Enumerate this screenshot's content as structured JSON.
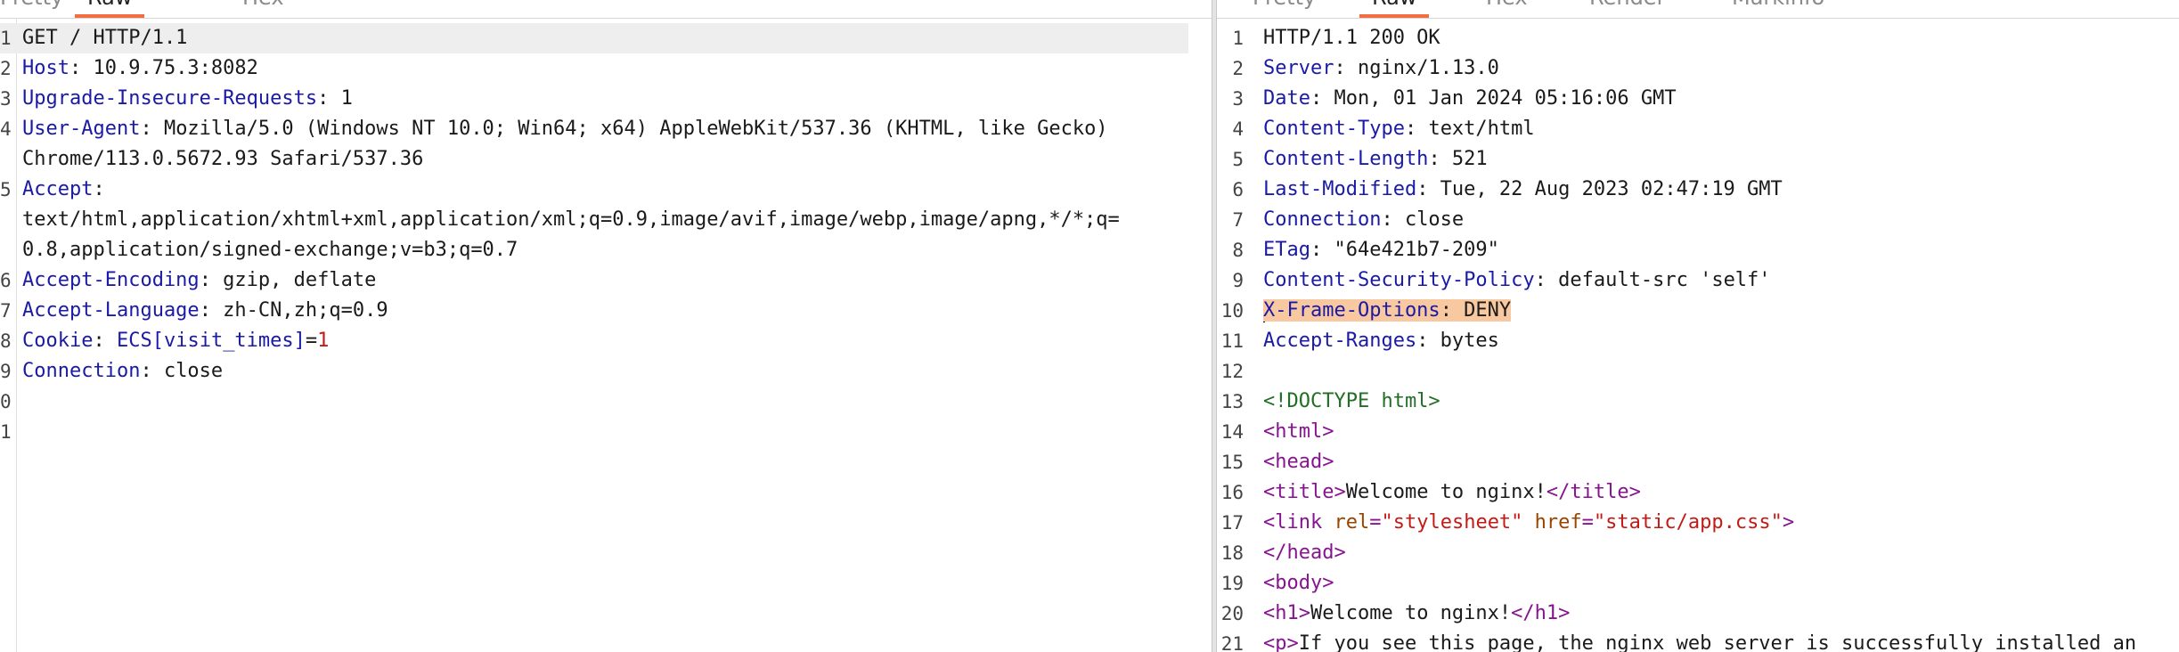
{
  "request": {
    "tabs": [
      "Pretty",
      "Raw",
      "Hex"
    ],
    "active_tab": "Raw",
    "lines": [
      {
        "n": "1",
        "parts": [
          {
            "t": "GET / HTTP/1.1",
            "c": "hv"
          }
        ]
      },
      {
        "n": "2",
        "parts": [
          {
            "t": "Host",
            "c": "hk"
          },
          {
            "t": ": 10.9.75.3:8082",
            "c": "hv"
          }
        ]
      },
      {
        "n": "3",
        "parts": [
          {
            "t": "Upgrade-Insecure-Requests",
            "c": "hk"
          },
          {
            "t": ": 1",
            "c": "hv"
          }
        ]
      },
      {
        "n": "4",
        "parts": [
          {
            "t": "User-Agent",
            "c": "hk"
          },
          {
            "t": ": Mozilla/5.0 (Windows NT 10.0; Win64; x64) AppleWebKit/537.36 (KHTML, like Gecko)",
            "c": "hv"
          }
        ]
      },
      {
        "n": "",
        "parts": [
          {
            "t": "Chrome/113.0.5672.93 Safari/537.36",
            "c": "hv"
          }
        ]
      },
      {
        "n": "5",
        "parts": [
          {
            "t": "Accept",
            "c": "hk"
          },
          {
            "t": ":",
            "c": "hv"
          }
        ]
      },
      {
        "n": "",
        "parts": [
          {
            "t": "text/html,application/xhtml+xml,application/xml;q=0.9,image/avif,image/webp,image/apng,*/*;q=",
            "c": "hv"
          }
        ]
      },
      {
        "n": "",
        "parts": [
          {
            "t": "0.8,application/signed-exchange;v=b3;q=0.7",
            "c": "hv"
          }
        ]
      },
      {
        "n": "6",
        "parts": [
          {
            "t": "Accept-Encoding",
            "c": "hk"
          },
          {
            "t": ": gzip, deflate",
            "c": "hv"
          }
        ]
      },
      {
        "n": "7",
        "parts": [
          {
            "t": "Accept-Language",
            "c": "hk"
          },
          {
            "t": ": zh-CN,zh;q=0.9",
            "c": "hv"
          }
        ]
      },
      {
        "n": "8",
        "parts": [
          {
            "t": "Cookie",
            "c": "hk"
          },
          {
            "t": ": ",
            "c": "hv"
          },
          {
            "t": "ECS[visit_times]",
            "c": "hk"
          },
          {
            "t": "=",
            "c": "hv"
          },
          {
            "t": "1",
            "c": "red"
          }
        ]
      },
      {
        "n": "9",
        "parts": [
          {
            "t": "Connection",
            "c": "hk"
          },
          {
            "t": ": close",
            "c": "hv"
          }
        ]
      },
      {
        "n": "0",
        "parts": []
      },
      {
        "n": "1",
        "parts": []
      }
    ]
  },
  "response": {
    "tabs": [
      "Pretty",
      "Raw",
      "Hex",
      "Render",
      "Markinfo"
    ],
    "active_tab": "Raw",
    "lines": [
      {
        "n": "1",
        "parts": [
          {
            "t": "HTTP/1.1 200 OK",
            "c": "hv"
          }
        ]
      },
      {
        "n": "2",
        "parts": [
          {
            "t": "Server",
            "c": "hk"
          },
          {
            "t": ": nginx/1.13.0",
            "c": "hv"
          }
        ]
      },
      {
        "n": "3",
        "parts": [
          {
            "t": "Date",
            "c": "hk"
          },
          {
            "t": ": Mon, 01 Jan 2024 05:16:06 GMT",
            "c": "hv"
          }
        ]
      },
      {
        "n": "4",
        "parts": [
          {
            "t": "Content-Type",
            "c": "hk"
          },
          {
            "t": ": text/html",
            "c": "hv"
          }
        ]
      },
      {
        "n": "5",
        "parts": [
          {
            "t": "Content-Length",
            "c": "hk"
          },
          {
            "t": ": 521",
            "c": "hv"
          }
        ]
      },
      {
        "n": "6",
        "parts": [
          {
            "t": "Last-Modified",
            "c": "hk"
          },
          {
            "t": ": Tue, 22 Aug 2023 02:47:19 GMT",
            "c": "hv"
          }
        ]
      },
      {
        "n": "7",
        "parts": [
          {
            "t": "Connection",
            "c": "hk"
          },
          {
            "t": ": close",
            "c": "hv"
          }
        ]
      },
      {
        "n": "8",
        "parts": [
          {
            "t": "ETag",
            "c": "hk"
          },
          {
            "t": ": \"64e421b7-209\"",
            "c": "hv"
          }
        ]
      },
      {
        "n": "9",
        "parts": [
          {
            "t": "Content-Security-Policy",
            "c": "hk"
          },
          {
            "t": ": default-src 'self'",
            "c": "hv"
          }
        ]
      },
      {
        "n": "10",
        "parts": [
          {
            "t": "X-Frame-Options",
            "c": "hk hl"
          },
          {
            "t": ": DENY",
            "c": "hv hl"
          }
        ]
      },
      {
        "n": "11",
        "parts": [
          {
            "t": "Accept-Ranges",
            "c": "hk"
          },
          {
            "t": ": bytes",
            "c": "hv"
          }
        ]
      },
      {
        "n": "12",
        "parts": []
      },
      {
        "n": "13",
        "parts": [
          {
            "t": "<!DOCTYPE html>",
            "c": "doct"
          }
        ]
      },
      {
        "n": "14",
        "parts": [
          {
            "t": "<html>",
            "c": "tag"
          }
        ]
      },
      {
        "n": "15",
        "parts": [
          {
            "t": "<head>",
            "c": "tag"
          }
        ]
      },
      {
        "n": "16",
        "parts": [
          {
            "t": "<title>",
            "c": "tag"
          },
          {
            "t": "Welcome to nginx!",
            "c": "hv"
          },
          {
            "t": "</title>",
            "c": "tag"
          }
        ]
      },
      {
        "n": "17",
        "parts": [
          {
            "t": "<link ",
            "c": "tag"
          },
          {
            "t": "rel",
            "c": "attr"
          },
          {
            "t": "=",
            "c": "tag"
          },
          {
            "t": "\"stylesheet\"",
            "c": "str"
          },
          {
            "t": " href",
            "c": "attr"
          },
          {
            "t": "=",
            "c": "tag"
          },
          {
            "t": "\"static/app.css\"",
            "c": "str"
          },
          {
            "t": ">",
            "c": "tag"
          }
        ]
      },
      {
        "n": "18",
        "parts": [
          {
            "t": "</head>",
            "c": "tag"
          }
        ]
      },
      {
        "n": "19",
        "parts": [
          {
            "t": "<body>",
            "c": "tag"
          }
        ]
      },
      {
        "n": "20",
        "parts": [
          {
            "t": "<h1>",
            "c": "tag"
          },
          {
            "t": "Welcome to nginx!",
            "c": "hv"
          },
          {
            "t": "</h1>",
            "c": "tag"
          }
        ]
      },
      {
        "n": "21",
        "parts": [
          {
            "t": "<p>",
            "c": "tag"
          },
          {
            "t": "If you see this page, the nginx web server is successfully installed an",
            "c": "hv"
          }
        ]
      }
    ]
  }
}
